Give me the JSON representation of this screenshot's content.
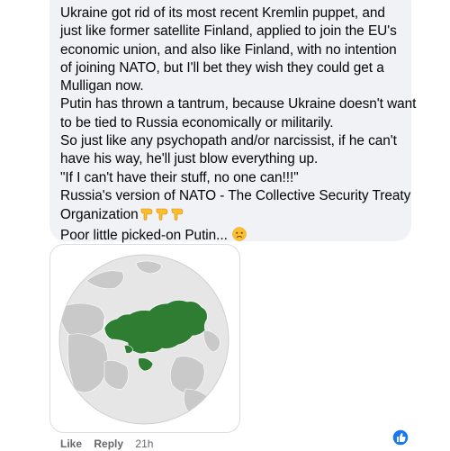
{
  "comment": {
    "lines": [
      "Ukraine got rid of its most recent Kremlin puppet, and",
      "just like former satellite Finland, applied to join the EU's",
      "economic union, and also like Finland, with no intention",
      "of joining NATO, but I'll bet they wish they could get a",
      "Mulligan now.",
      "Putin has thrown a tantrum, because Ukraine doesn't want",
      "to be tied to Russia economically or militarily.",
      "So just like any psychopath and/or narcissist, if he can't",
      "have his way, he'll just blow everything up.",
      "\"If I can't have their stuff, no one can!!!\"",
      "Russia's version of NATO - The Collective Security Treaty",
      "Organization",
      "Poor little picked-on Putin..."
    ],
    "emojis": {
      "pointing": "pointing-down-hand-emoji",
      "face": "disappointed-face-emoji"
    }
  },
  "attachment": {
    "kind": "globe-map-image",
    "colors": {
      "ocean": "#e4e4e4",
      "land": "#c8c8c8",
      "highlight": "#2e7d32",
      "border": "#ffffff"
    }
  },
  "actions": {
    "like": "Like",
    "reply": "Reply",
    "time": "21h"
  },
  "reaction": {
    "icon": "like-thumb-icon",
    "color": "#1877f2"
  }
}
